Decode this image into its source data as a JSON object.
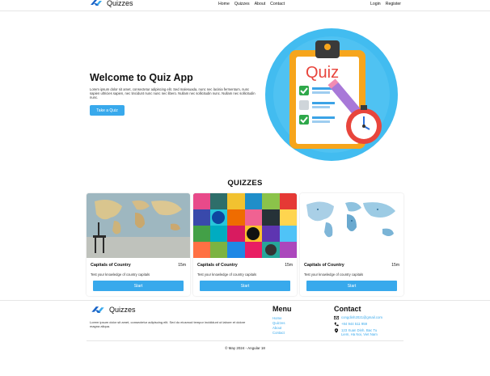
{
  "nav": {
    "brand": "Quizzes",
    "links": [
      "Home",
      "Quizzes",
      "About",
      "Contact"
    ],
    "login": "Login",
    "register": "Register"
  },
  "hero": {
    "title": "Welcome to Quiz App",
    "description": "Lorem ipsum dolor sit amet, consectetur adipiscing elit. Sed malesuada, nunc nec lacinia fermentum, nunc sapien ultricies sapien, nec tincidunt nunc nunc nec libero. Nullam nec sollicitudin nunc. Nullam nec sollicitudin nunc.",
    "button": "Take a Quiz",
    "illustration_text": "Quiz"
  },
  "quizzes": {
    "title": "QUIZZES",
    "cards": [
      {
        "title": "Capitals of Country",
        "duration": "15m",
        "description": "Test your knowledge of country capitals",
        "button": "Start",
        "image": "world-map-wall-icon"
      },
      {
        "title": "Capitals of Country",
        "duration": "15m",
        "description": "Test your knowledge of country capitals",
        "button": "Start",
        "image": "colorful-collage-icon"
      },
      {
        "title": "Capitals of Country",
        "duration": "15m",
        "description": "Test your knowledge of country capitals",
        "button": "Start",
        "image": "blue-world-map-icon"
      }
    ]
  },
  "footer": {
    "brand": "Quizzes",
    "description": "Lorem ipsum dolor sit amet, consectetur adipiscing elit. Sed do eiusmod tempor incididunt ut labore et dolore magna aliqua.",
    "menu_title": "Menu",
    "menu": [
      "Home",
      "Quizzes",
      "About",
      "Contact"
    ],
    "contact_title": "Contact",
    "email": "congdinh2021@gmail.com",
    "phone": "+84 944 511 959",
    "address_line1": "123 Xuan Dinh, Bac Tu",
    "address_line2": "Liem, Ha Noi, Viet Nam",
    "copyright": "© May 2024 - Angular 18"
  },
  "colors": {
    "accent": "#38a9ec",
    "brand_dark": "#1a64c8"
  }
}
